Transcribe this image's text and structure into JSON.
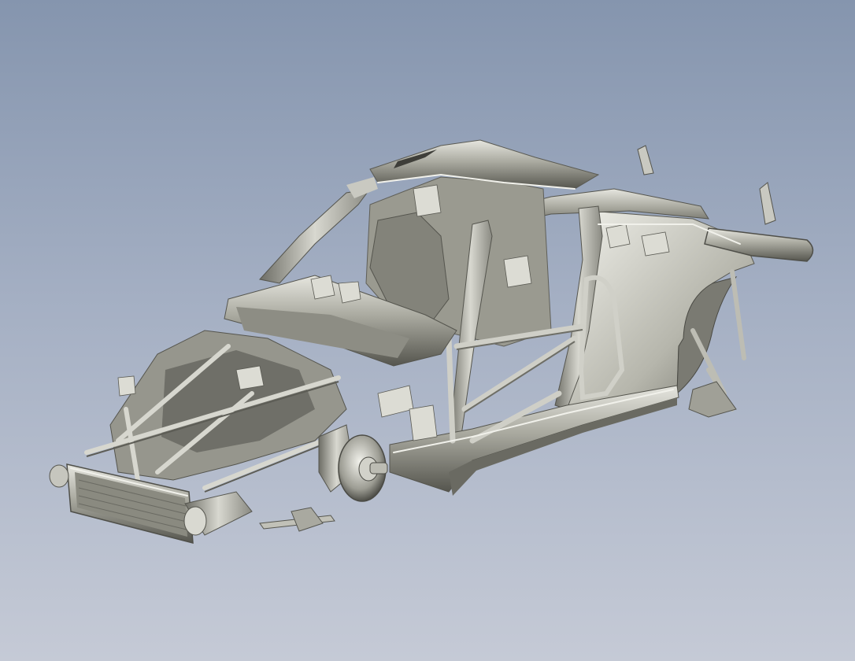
{
  "viewport": {
    "background_top": "#8595ae",
    "background_bottom": "#c5cad6"
  },
  "model": {
    "kind": "3d-scan-mesh",
    "subject": "race-car-chassis-shell",
    "render_style": "metallic-gray-shaded",
    "base_color": "#a8a89e",
    "highlight_color": "#ecece6",
    "shadow_color": "#45453f"
  }
}
